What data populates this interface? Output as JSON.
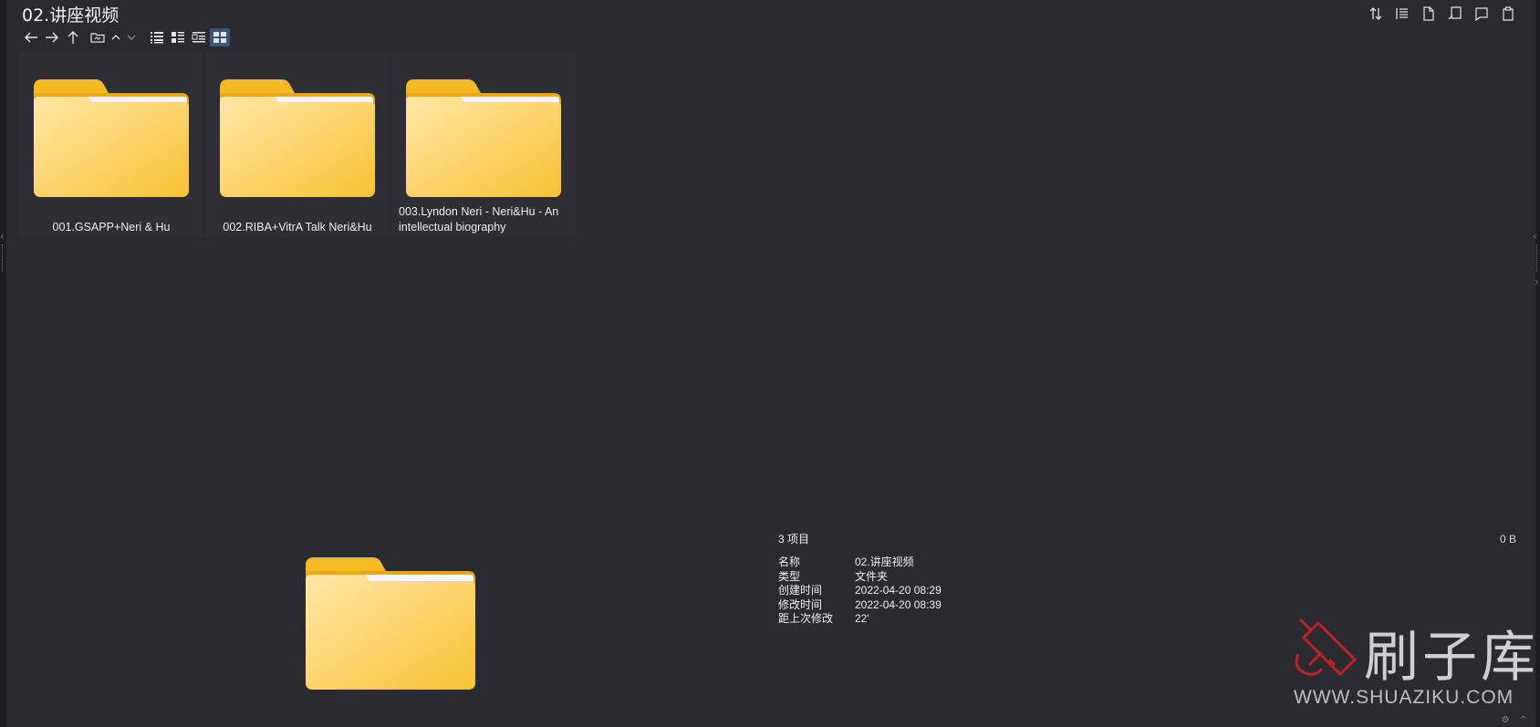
{
  "window": {
    "title": "02.讲座视频"
  },
  "nav": {
    "back": "back-arrow",
    "forward": "forward-arrow",
    "up": "up-arrow",
    "views": [
      "details-view",
      "list-view",
      "tiles-view",
      "thumbnails-view"
    ],
    "active_view": "thumbnails-view"
  },
  "items": [
    {
      "name": "001.GSAPP+Neri & Hu",
      "type": "folder"
    },
    {
      "name": "002.RIBA+VitrA Talk Neri&Hu",
      "type": "folder"
    },
    {
      "name": "003.Lyndon Neri - Neri&Hu - An intellectual biography",
      "type": "folder"
    }
  ],
  "details": {
    "count": "3 项目",
    "size": "0 B",
    "rows": [
      {
        "key": "名称",
        "value": "02.讲座视频"
      },
      {
        "key": "类型",
        "value": "文件夹"
      },
      {
        "key": "创建时间",
        "value": "2022-04-20  08:29"
      },
      {
        "key": "修改时间",
        "value": "2022-04-20  08:39"
      },
      {
        "key": "距上次修改",
        "value": "22'"
      }
    ]
  },
  "watermark": {
    "text": "刷子库",
    "url": "WWW.SHUAZIKU.COM"
  },
  "colors": {
    "background": "#2b2a30",
    "folder_light": "#ffe29a",
    "folder_dark": "#f7bc29",
    "active_view": "#3b5572"
  }
}
